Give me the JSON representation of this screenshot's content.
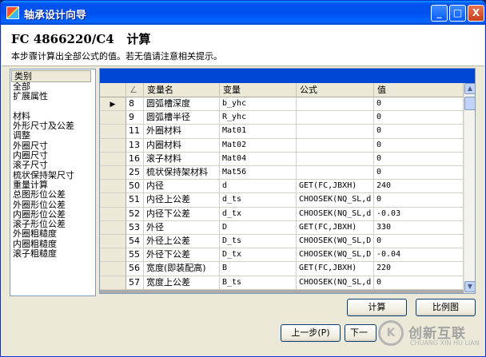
{
  "window": {
    "title": "轴承设计向导",
    "minimize_glyph": "_",
    "maximize_glyph": "□",
    "close_glyph": "X"
  },
  "header": {
    "code": "FC 4866220/C4",
    "step_title": "计算",
    "subtitle": "本步骤计算出全部公式的值。若无值请注意相关提示。"
  },
  "category": {
    "heading": "类别",
    "items": [
      "全部",
      "扩展属性",
      "",
      "材料",
      "外形尺寸及公差",
      "调整",
      "外圈尺寸",
      "内圈尺寸",
      "滚子尺寸",
      "梳状保持架尺寸",
      "重量计算",
      "总图形位公差",
      "外圈形位公差",
      "内圈形位公差",
      "滚子形位公差",
      "外圈粗糙度",
      "内圈粗糙度",
      "滚子粗糙度"
    ]
  },
  "grid": {
    "columns": [
      "",
      "变量名",
      "变量",
      "公式",
      "值"
    ],
    "sort_glyph": "∠",
    "current_row_marker": "▶",
    "rows": [
      {
        "id": "8",
        "name": "圆弧槽深度",
        "var": "b_yhc",
        "formula": "",
        "value": "0"
      },
      {
        "id": "9",
        "name": "圆弧槽半径",
        "var": "R_yhc",
        "formula": "",
        "value": "0"
      },
      {
        "id": "11",
        "name": "外圈材料",
        "var": "Mat01",
        "formula": "",
        "value": "0"
      },
      {
        "id": "13",
        "name": "内圈材料",
        "var": "Mat02",
        "formula": "",
        "value": "0"
      },
      {
        "id": "16",
        "name": "滚子材料",
        "var": "Mat04",
        "formula": "",
        "value": "0"
      },
      {
        "id": "25",
        "name": "梳状保持架材料",
        "var": "Mat56",
        "formula": "",
        "value": "0"
      },
      {
        "id": "50",
        "name": "内径",
        "var": "d",
        "formula": "GET(FC,JBXH)",
        "value": "240"
      },
      {
        "id": "51",
        "name": "内径上公差",
        "var": "d_ts",
        "formula": "CHOOSEK(NQ_SL,d",
        "value": "0"
      },
      {
        "id": "52",
        "name": "内径下公差",
        "var": "d_tx",
        "formula": "CHOOSEK(NQ_SL,d",
        "value": "-0.03"
      },
      {
        "id": "53",
        "name": "外径",
        "var": "D",
        "formula": "GET(FC,JBXH)",
        "value": "330"
      },
      {
        "id": "54",
        "name": "外径上公差",
        "var": "D_ts",
        "formula": "CHOOSEK(WQ_SL,D",
        "value": "0"
      },
      {
        "id": "55",
        "name": "外径下公差",
        "var": "D_tx",
        "formula": "CHOOSEK(WQ_SL,D",
        "value": "-0.04"
      },
      {
        "id": "56",
        "name": "宽度(即装配高)",
        "var": "B",
        "formula": "GET(FC,JBXH)",
        "value": "220"
      },
      {
        "id": "57",
        "name": "宽度上公差",
        "var": "B_ts",
        "formula": "CHOOSEK(NQ_SL,d",
        "value": "0"
      }
    ]
  },
  "scrollbar": {
    "up_glyph": "▲",
    "down_glyph": "▼"
  },
  "buttons": {
    "calculate": "计算",
    "scale_chart": "比例图",
    "prev": "上一步(P)",
    "next": "下一"
  },
  "watermark": {
    "logo_glyph": "K",
    "cn": "创新互联",
    "en": "CHUANG XIN HU LIAN"
  }
}
